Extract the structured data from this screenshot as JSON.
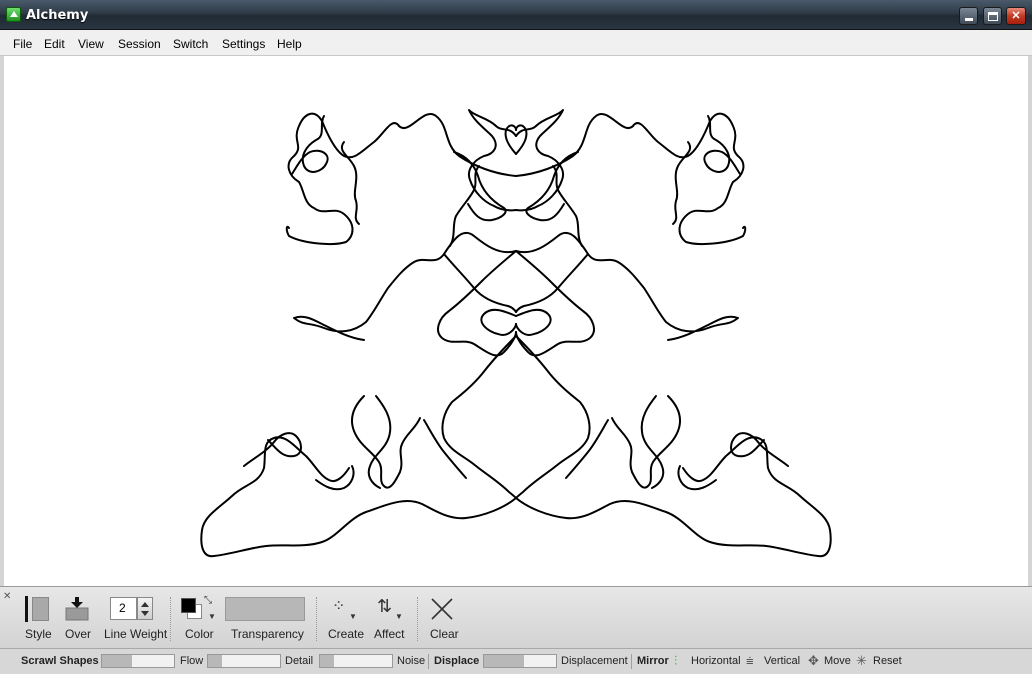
{
  "window": {
    "title": "Alchemy"
  },
  "menu": [
    "File",
    "Edit",
    "View",
    "Session",
    "Switch",
    "Settings",
    "Help"
  ],
  "toolbar": {
    "style_label": "Style",
    "over_label": "Over",
    "line_weight_label": "Line Weight",
    "line_weight_value": "2",
    "color_label": "Color",
    "transparency_label": "Transparency",
    "create_label": "Create",
    "affect_label": "Affect",
    "clear_label": "Clear",
    "foreground_color": "#000000",
    "background_color": "#ffffff"
  },
  "controls": {
    "module_name": "Scrawl Shapes",
    "flow_label": "Flow",
    "flow_level": 0.42,
    "detail_label": "Detail",
    "detail_level": 0.2,
    "noise_label": "Noise",
    "noise_level": 0.2,
    "displace_name": "Displace",
    "displacement_label": "Displacement",
    "displacement_level": 0.55,
    "mirror_name": "Mirror",
    "horizontal_label": "Horizontal",
    "vertical_label": "Vertical",
    "move_label": "Move",
    "reset_label": "Reset",
    "horizontal_active_color": "#22bb22"
  },
  "icons": {
    "app": "alchemy-app-icon",
    "minimize": "minimize-icon",
    "maximize": "maximize-icon",
    "close": "close-icon",
    "create": "create-icon",
    "affect": "affect-icon",
    "clear": "clear-x-icon"
  }
}
